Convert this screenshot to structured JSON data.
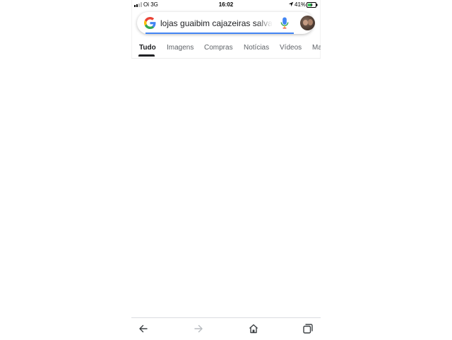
{
  "status_bar": {
    "carrier": "Oi  3G",
    "time": "16:02",
    "battery": "41%",
    "icons": [
      "signal-icon",
      "location-arrow-icon",
      "battery-charging-icon"
    ]
  },
  "search": {
    "query": "lojas guaibim cajazeiras salva",
    "logo_icon": "google-g-icon",
    "mic_icon": "microphone-icon",
    "avatar": "profile-avatar"
  },
  "tabs": [
    {
      "label": "Tudo",
      "active": true
    },
    {
      "label": "Imagens",
      "active": false
    },
    {
      "label": "Compras",
      "active": false
    },
    {
      "label": "Notícias",
      "active": false
    },
    {
      "label": "Vídeos",
      "active": false
    },
    {
      "label": "Ma",
      "active": false
    }
  ],
  "toolbar": {
    "icons": [
      "back-arrow-icon",
      "forward-arrow-icon",
      "home-icon",
      "tabs-icon"
    ]
  },
  "colors": {
    "accent_blue": "#4285f4",
    "text_primary": "#202124",
    "text_secondary": "#5f6368"
  }
}
